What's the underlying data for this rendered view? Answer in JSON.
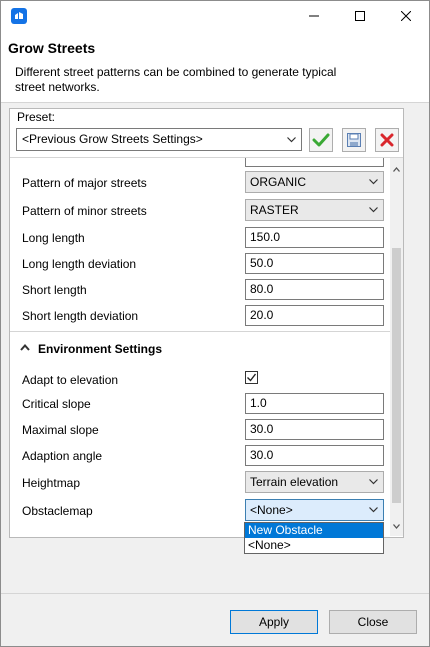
{
  "window": {
    "title": "Grow Streets",
    "description": "Different street patterns can be combined to generate typical street networks."
  },
  "preset": {
    "label": "Preset:",
    "value": "<Previous Grow Streets Settings>"
  },
  "rows": {
    "pattern_major": {
      "label": "Pattern of major streets",
      "value": "ORGANIC"
    },
    "pattern_minor": {
      "label": "Pattern of minor streets",
      "value": "RASTER"
    },
    "long_length": {
      "label": "Long length",
      "value": "150.0"
    },
    "long_length_dev": {
      "label": "Long length deviation",
      "value": "50.0"
    },
    "short_length": {
      "label": "Short length",
      "value": "80.0"
    },
    "short_length_dev": {
      "label": "Short length deviation",
      "value": "20.0"
    }
  },
  "environment": {
    "title": "Environment Settings",
    "adapt_to_elevation": {
      "label": "Adapt to elevation",
      "checked": true
    },
    "critical_slope": {
      "label": "Critical slope",
      "value": "1.0"
    },
    "maximal_slope": {
      "label": "Maximal slope",
      "value": "30.0"
    },
    "adaption_angle": {
      "label": "Adaption angle",
      "value": "30.0"
    },
    "heightmap": {
      "label": "Heightmap",
      "value": "Terrain elevation"
    },
    "obstaclemap": {
      "label": "Obstaclemap",
      "value": "<None>"
    }
  },
  "dropdown": {
    "options": [
      "New Obstacle",
      "<None>"
    ],
    "highlighted": "New Obstacle"
  },
  "buttons": {
    "apply": "Apply",
    "close": "Close"
  },
  "colors": {
    "accent": "#0078d7",
    "accept": "#3aa935",
    "remove": "#d9262c"
  }
}
